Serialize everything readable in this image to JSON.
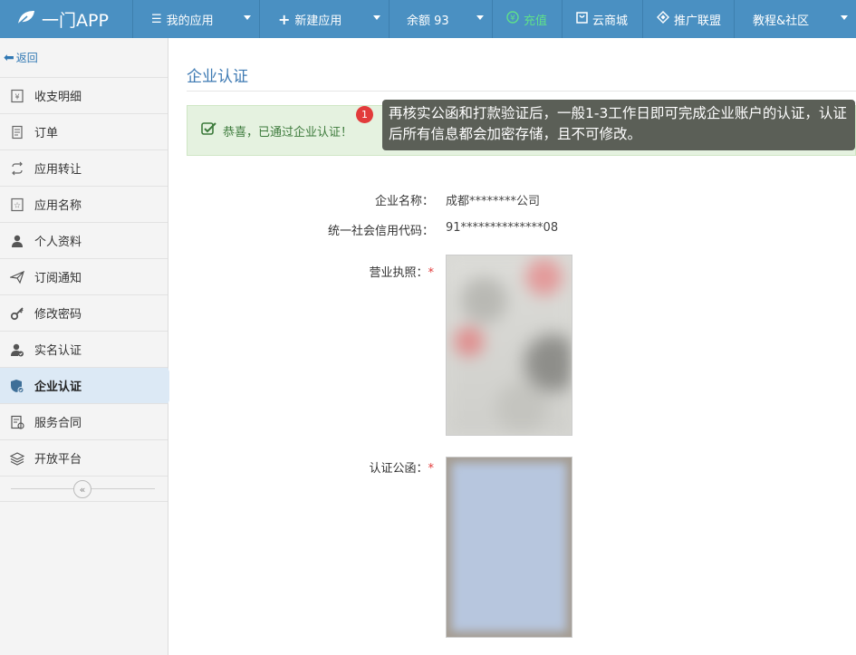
{
  "topbar": {
    "logo": "一门APP",
    "my_apps": "我的应用",
    "new_app": "新建应用",
    "balance": "余额 93",
    "recharge": "充值",
    "cloud_store": "云商城",
    "affiliate": "推广联盟",
    "tutorial": "教程&社区"
  },
  "sidebar": {
    "back": "返回",
    "items": [
      {
        "label": "收支明细",
        "icon": "ledger-icon"
      },
      {
        "label": "订单",
        "icon": "order-icon"
      },
      {
        "label": "应用转让",
        "icon": "transfer-icon"
      },
      {
        "label": "应用名称",
        "icon": "star-icon"
      },
      {
        "label": "个人资料",
        "icon": "user-icon"
      },
      {
        "label": "订阅通知",
        "icon": "paper-plane-icon"
      },
      {
        "label": "修改密码",
        "icon": "key-icon"
      },
      {
        "label": "实名认证",
        "icon": "user-check-icon"
      },
      {
        "label": "企业认证",
        "icon": "enterprise-shield-icon"
      },
      {
        "label": "服务合同",
        "icon": "contract-icon"
      },
      {
        "label": "开放平台",
        "icon": "layers-icon"
      }
    ],
    "active_index": 8
  },
  "main": {
    "title": "企业认证",
    "alert": "恭喜，已通过企业认证！",
    "badge": "1",
    "tooltip": "再核实公函和打款验证后，一般1-3工作日即可完成企业账户的认证，认证后所有信息都会加密存储，且不可修改。",
    "company_label": "企业名称：",
    "company_value": "成都********公司",
    "credit_label": "统一社会信用代码：",
    "credit_value": "91**************08",
    "license_label": "营业执照：",
    "letter_label": "认证公函：",
    "required_mark": "*"
  },
  "colors": {
    "topbar": "#4a90c2",
    "accent": "#3e7ab3",
    "success_bg": "#e5f2e0",
    "recharge": "#5fe08a",
    "required": "#e23b3b"
  }
}
